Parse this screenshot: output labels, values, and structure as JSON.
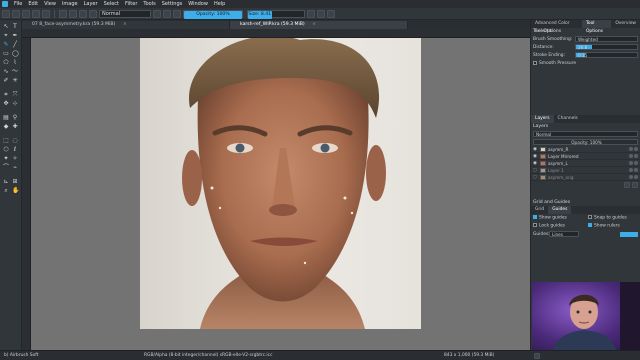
{
  "menu": [
    "File",
    "Edit",
    "View",
    "Image",
    "Layer",
    "Select",
    "Filter",
    "Tools",
    "Settings",
    "Window",
    "Help"
  ],
  "toolbar": {
    "blend_mode": "Normal",
    "opacity_label": "Opacity: 100%",
    "size_label": "Size: 8.41 px"
  },
  "tabs": [
    {
      "label": "07 8_face-asymmetry.kra (59.3 MiB)",
      "active": false
    },
    {
      "label": "karsh-ref_WIP.kra (59.3 MiB)",
      "active": true
    }
  ],
  "docker": {
    "top_tabs": [
      "Advanced Color Selector",
      "Tool Options",
      "Overview"
    ],
    "tool_options_title": "Tool Options",
    "brush_smoothing_label": "Brush Smoothing:",
    "brush_smoothing_value": "Weighted",
    "distance_label": "Distance:",
    "distance_value": "26.8",
    "distance_fraction": 0.27,
    "stroke_ending_label": "Stroke Ending:",
    "stroke_ending_value": "0.15",
    "stroke_ending_fraction": 0.15,
    "smooth_pressure_label": "Smooth Pressure",
    "layers_tabs": [
      "Layers",
      "Channels"
    ],
    "layers_title": "Layers",
    "layer_blend": "Normal",
    "layer_opacity": "Opacity: 100%",
    "layers": [
      {
        "name": "asymm_R",
        "selected": false
      },
      {
        "name": "Layer Mirrored",
        "selected": false
      },
      {
        "name": "asymm_L",
        "selected": false
      },
      {
        "name": "Layer 1",
        "selected": false
      },
      {
        "name": "asymm_orig",
        "selected": false
      }
    ],
    "grid_title": "Grid and Guides",
    "grid_tabs": [
      "Grid",
      "Guides"
    ],
    "show_guides": "Show guides",
    "snap_guides": "Snap to guides",
    "lock_guides": "Lock guides",
    "show_rulers": "Show rulers",
    "guides_label": "Guides:",
    "guides_type": "Lines",
    "guide_color": "#3daee9"
  },
  "status": {
    "brush": "b) Airbrush Soft",
    "color_info": "RGB/Alpha (8-bit integer/channel) sRGB-elle-V2-srgbtrc.icc",
    "size_info": "843 x 1,000 (59.3 MiB)"
  }
}
